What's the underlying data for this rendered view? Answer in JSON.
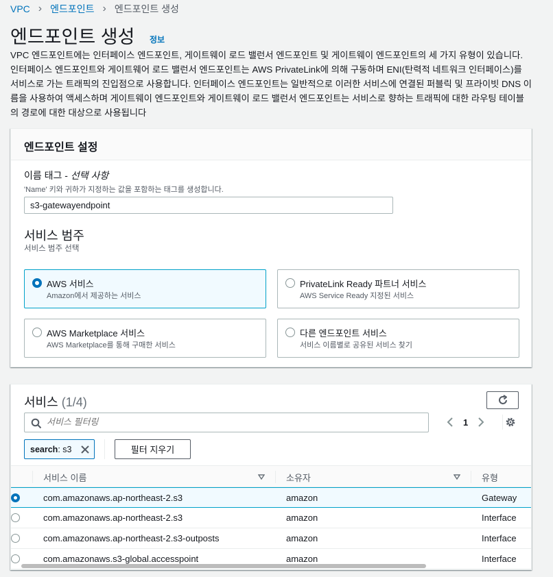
{
  "breadcrumb": {
    "root": "VPC",
    "parent": "엔드포인트",
    "current": "엔드포인트 생성"
  },
  "page": {
    "title": "엔드포인트 생성",
    "info": "정보",
    "description": "VPC 엔드포인트에는 인터페이스 엔드포인트, 게이트웨이 로드 밸런서 엔드포인트 및 게이트웨이 엔드포인트의 세 가지 유형이 있습니다. 인터페이스 엔드포인트와 게이트웨어 로드 밸런서 엔드포인트는 AWS PrivateLink에 의해 구동하며 ENI(탄력적 네트워크 인터페이스)를 서비스로 가는 트래픽의 진입점으로 사용합니다. 인터페이스 엔드포인트는 일반적으로 이러한 서비스에 연결된 퍼블릭 및 프라이빗 DNS 이름을 사용하여 액세스하며 게이트웨이 엔드포인트와 게이트웨이 로드 밸런서 엔드포인트는 서비스로 향하는 트래픽에 대한 라우팅 테이블의 경로에 대한 대상으로 사용됩니다"
  },
  "settings": {
    "title": "엔드포인트 설정",
    "name_tag": {
      "label": "이름 태그 - ",
      "optional": "선택 사항",
      "description": "'Name' 키와 귀하가 지정하는 값을 포함하는 태그를 생성합니다.",
      "value": "s3-gatewayendpoint"
    },
    "category": {
      "title": "서비스 범주",
      "description": "서비스 범주 선택",
      "options": [
        {
          "title": "AWS 서비스",
          "desc": "Amazon에서 제공하는 서비스",
          "selected": true
        },
        {
          "title": "PrivateLink Ready 파트너 서비스",
          "desc": "AWS Service Ready 지정된 서비스",
          "selected": false
        },
        {
          "title": "AWS Marketplace 서비스",
          "desc": "AWS Marketplace를 통해 구매한 서비스",
          "selected": false
        },
        {
          "title": "다른 엔드포인트 서비스",
          "desc": "서비스 이름별로 공유된 서비스 찾기",
          "selected": false
        }
      ]
    }
  },
  "services": {
    "title": "서비스",
    "count": "(1/4)",
    "filter_placeholder": "서비스 필터링",
    "page": "1",
    "token": {
      "key": "search",
      "value": ": s3"
    },
    "clear_filter": "필터 지우기",
    "columns": [
      "서비스 이름",
      "소유자",
      "유형"
    ],
    "rows": [
      {
        "name": "com.amazonaws.ap-northeast-2.s3",
        "owner": "amazon",
        "type": "Gateway",
        "selected": true
      },
      {
        "name": "com.amazonaws.ap-northeast-2.s3",
        "owner": "amazon",
        "type": "Interface",
        "selected": false
      },
      {
        "name": "com.amazonaws.ap-northeast-2.s3-outposts",
        "owner": "amazon",
        "type": "Interface",
        "selected": false
      },
      {
        "name": "com.amazonaws.s3-global.accesspoint",
        "owner": "amazon",
        "type": "Interface",
        "selected": false
      }
    ]
  },
  "icons": {
    "breadcrumb_separator": "chevron-right-icon",
    "search": "search-icon",
    "refresh": "refresh-icon",
    "settings": "gear-icon",
    "token_close": "close-icon",
    "sort": "caret-down-icon"
  },
  "colors": {
    "accent": "#0073bb",
    "selected_border": "#00a1c9",
    "selected_bg": "#f1faff"
  }
}
